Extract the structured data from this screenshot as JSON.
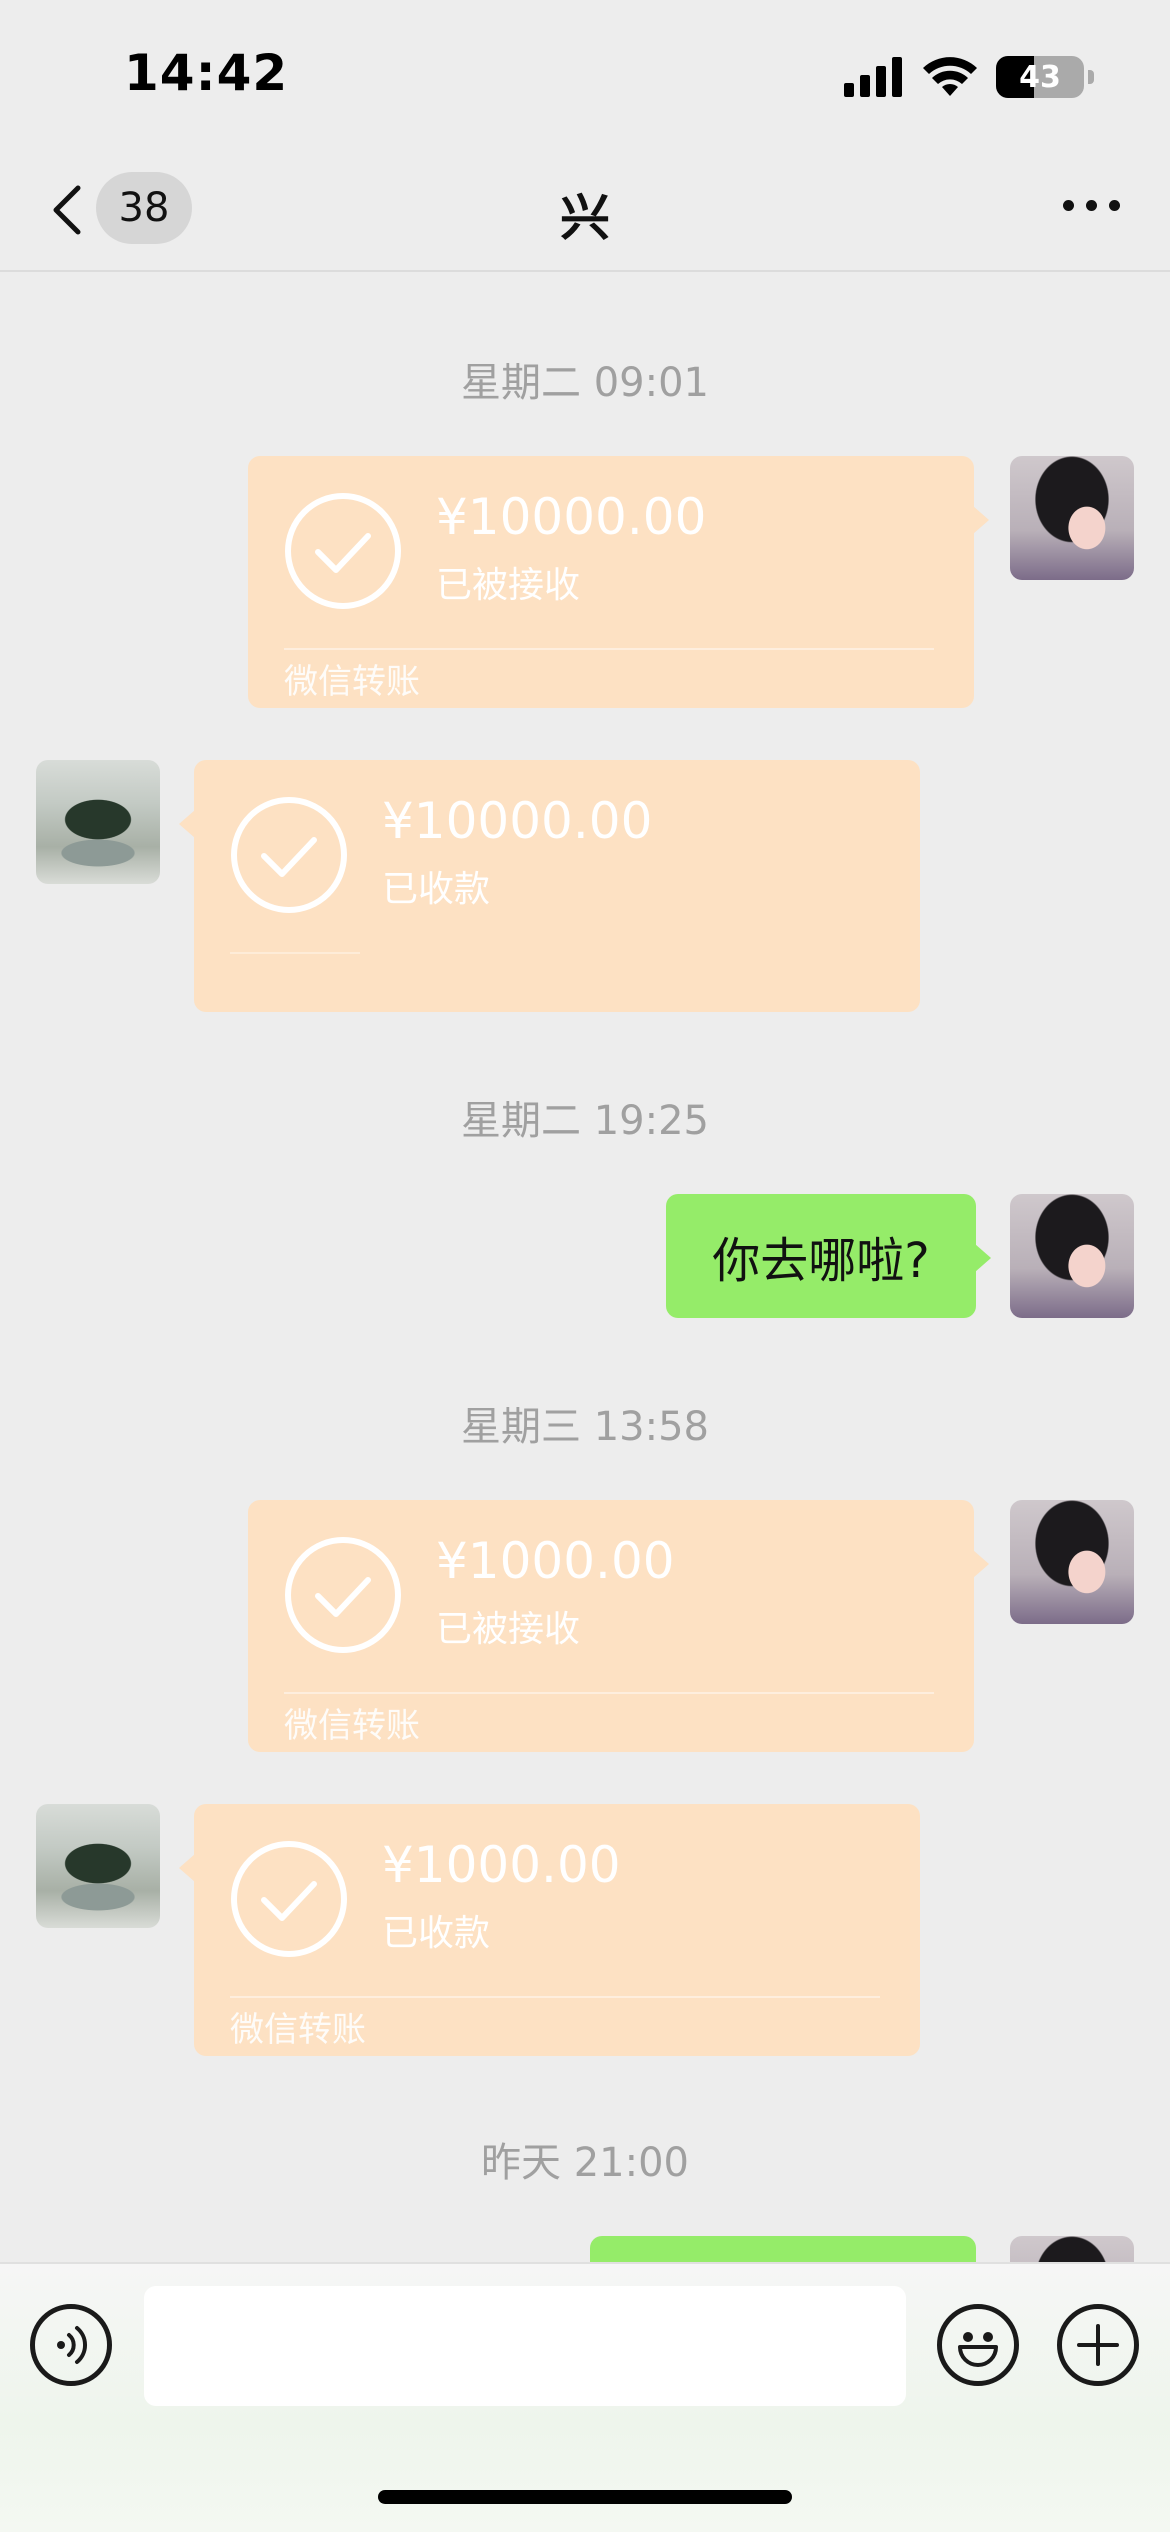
{
  "status_bar": {
    "time": "14:42",
    "battery": "43"
  },
  "nav": {
    "unread_count": "38",
    "title": "兴"
  },
  "messages": [
    {
      "type": "timestamp",
      "text": "星期二 09:01"
    },
    {
      "type": "transfer",
      "side": "right",
      "amount": "¥10000.00",
      "status": "已被接收",
      "footer": "微信转账"
    },
    {
      "type": "transfer",
      "side": "left",
      "amount": "¥10000.00",
      "status": "已收款",
      "footer": ""
    },
    {
      "type": "timestamp",
      "text": "星期二 19:25"
    },
    {
      "type": "text",
      "side": "right",
      "text": "你去哪啦?"
    },
    {
      "type": "timestamp",
      "text": "星期三 13:58"
    },
    {
      "type": "transfer",
      "side": "right",
      "amount": "¥1000.00",
      "status": "已被接收",
      "footer": "微信转账"
    },
    {
      "type": "transfer",
      "side": "left",
      "amount": "¥1000.00",
      "status": "已收款",
      "footer": "微信转账"
    },
    {
      "type": "timestamp",
      "text": "昨天 21:00"
    }
  ],
  "input": {
    "value": ""
  },
  "colors": {
    "transfer_bubble": "#fde1c3",
    "text_bubble": "#95ec69",
    "background": "#ededed"
  },
  "icons": [
    "back-chevron-icon",
    "more-icon",
    "voice-icon",
    "emoji-icon",
    "plus-icon",
    "signal-icon",
    "wifi-icon",
    "battery-icon",
    "check-icon"
  ]
}
